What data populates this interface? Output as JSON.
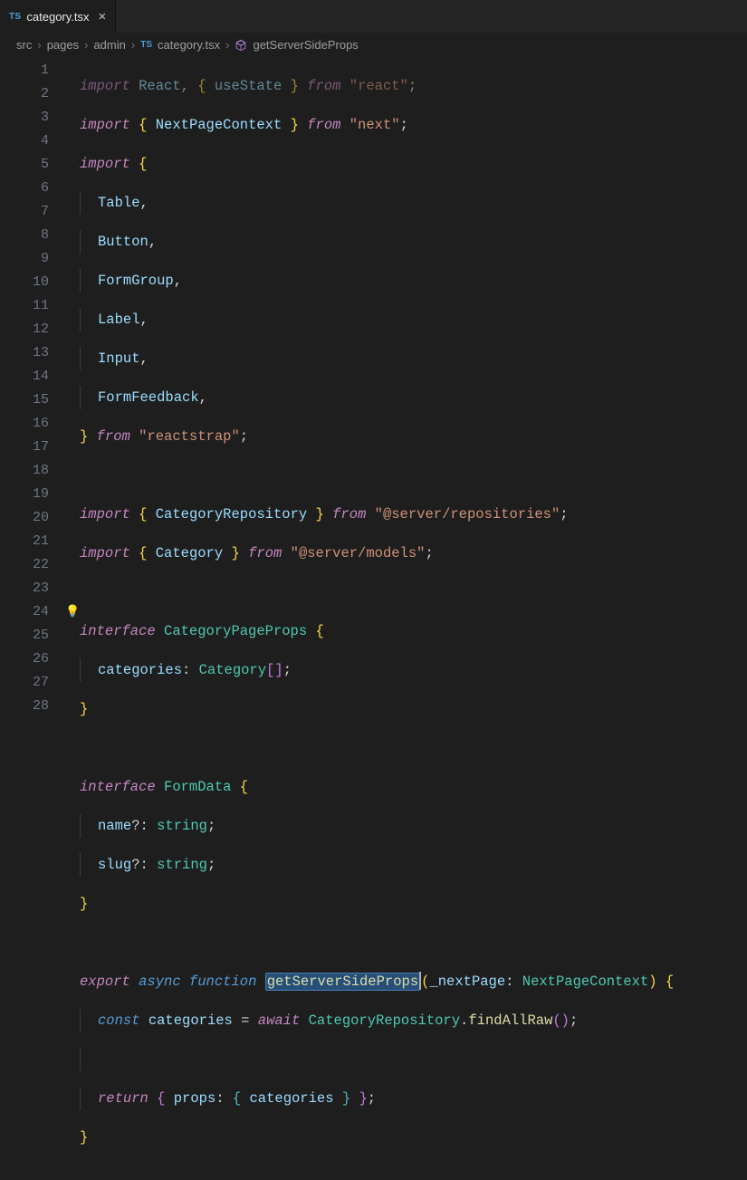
{
  "tab": {
    "badge": "TS",
    "filename": "category.tsx"
  },
  "breadcrumbs": {
    "items": [
      "src",
      "pages",
      "admin"
    ],
    "file_badge": "TS",
    "file": "category.tsx",
    "symbol": "getServerSideProps"
  },
  "line_numbers": [
    "1",
    "2",
    "3",
    "4",
    "5",
    "6",
    "7",
    "8",
    "9",
    "10",
    "11",
    "12",
    "13",
    "14",
    "15",
    "16",
    "17",
    "18",
    "19",
    "20",
    "21",
    "22",
    "23",
    "24",
    "25",
    "26",
    "27",
    "28"
  ],
  "code": {
    "l1": {
      "a": "import",
      "b": "React",
      "c": "useState",
      "d": "from",
      "e": "\"react\""
    },
    "l2": {
      "a": "import",
      "b": "NextPageContext",
      "c": "from",
      "d": "\"next\""
    },
    "l3": {
      "a": "import"
    },
    "l4": {
      "a": "Table"
    },
    "l5": {
      "a": "Button"
    },
    "l6": {
      "a": "FormGroup"
    },
    "l7": {
      "a": "Label"
    },
    "l8": {
      "a": "Input"
    },
    "l9": {
      "a": "FormFeedback"
    },
    "l10": {
      "a": "from",
      "b": "\"reactstrap\""
    },
    "l12": {
      "a": "import",
      "b": "CategoryRepository",
      "c": "from",
      "d": "\"@server/repositories\""
    },
    "l13": {
      "a": "import",
      "b": "Category",
      "c": "from",
      "d": "\"@server/models\""
    },
    "l15": {
      "a": "interface",
      "b": "CategoryPageProps"
    },
    "l16": {
      "a": "categories",
      "b": "Category"
    },
    "l17": {},
    "l19": {
      "a": "interface",
      "b": "FormData"
    },
    "l20": {
      "a": "name",
      "b": "string"
    },
    "l21": {
      "a": "slug",
      "b": "string"
    },
    "l22": {},
    "l24": {
      "a": "export",
      "b": "async",
      "c": "function",
      "d": "getServerSideProps",
      "e": "_nextPage",
      "f": "NextPageContext"
    },
    "l25": {
      "a": "const",
      "b": "categories",
      "c": "await",
      "d": "CategoryRepository",
      "e": "findAllRaw"
    },
    "l27": {
      "a": "return",
      "b": "props",
      "c": "categories"
    },
    "l28": {}
  }
}
